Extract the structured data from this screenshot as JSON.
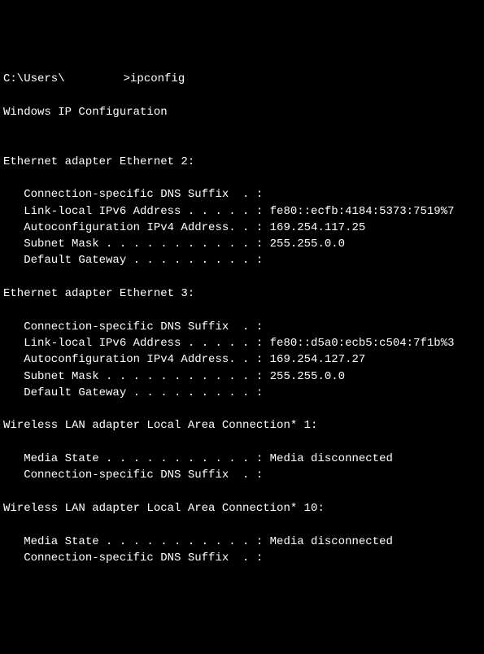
{
  "prompt_prefix": "C:\\Users\\",
  "prompt_suffix": ">ipconfig",
  "header": "Windows IP Configuration",
  "adapters": [
    {
      "title": "Ethernet adapter Ethernet 2:",
      "rows": [
        {
          "label": "   Connection-specific DNS Suffix  . :",
          "value": ""
        },
        {
          "label": "   Link-local IPv6 Address . . . . . :",
          "value": " fe80::ecfb:4184:5373:7519%7"
        },
        {
          "label": "   Autoconfiguration IPv4 Address. . :",
          "value": " 169.254.117.25"
        },
        {
          "label": "   Subnet Mask . . . . . . . . . . . :",
          "value": " 255.255.0.0"
        },
        {
          "label": "   Default Gateway . . . . . . . . . :",
          "value": ""
        }
      ]
    },
    {
      "title": "Ethernet adapter Ethernet 3:",
      "rows": [
        {
          "label": "   Connection-specific DNS Suffix  . :",
          "value": ""
        },
        {
          "label": "   Link-local IPv6 Address . . . . . :",
          "value": " fe80::d5a0:ecb5:c504:7f1b%3"
        },
        {
          "label": "   Autoconfiguration IPv4 Address. . :",
          "value": " 169.254.127.27"
        },
        {
          "label": "   Subnet Mask . . . . . . . . . . . :",
          "value": " 255.255.0.0"
        },
        {
          "label": "   Default Gateway . . . . . . . . . :",
          "value": ""
        }
      ]
    },
    {
      "title": "Wireless LAN adapter Local Area Connection* 1:",
      "rows": [
        {
          "label": "   Media State . . . . . . . . . . . :",
          "value": " Media disconnected"
        },
        {
          "label": "   Connection-specific DNS Suffix  . :",
          "value": ""
        }
      ]
    },
    {
      "title": "Wireless LAN adapter Local Area Connection* 10:",
      "rows": [
        {
          "label": "   Media State . . . . . . . . . . . :",
          "value": " Media disconnected"
        },
        {
          "label": "   Connection-specific DNS Suffix  . :",
          "value": ""
        }
      ]
    }
  ]
}
